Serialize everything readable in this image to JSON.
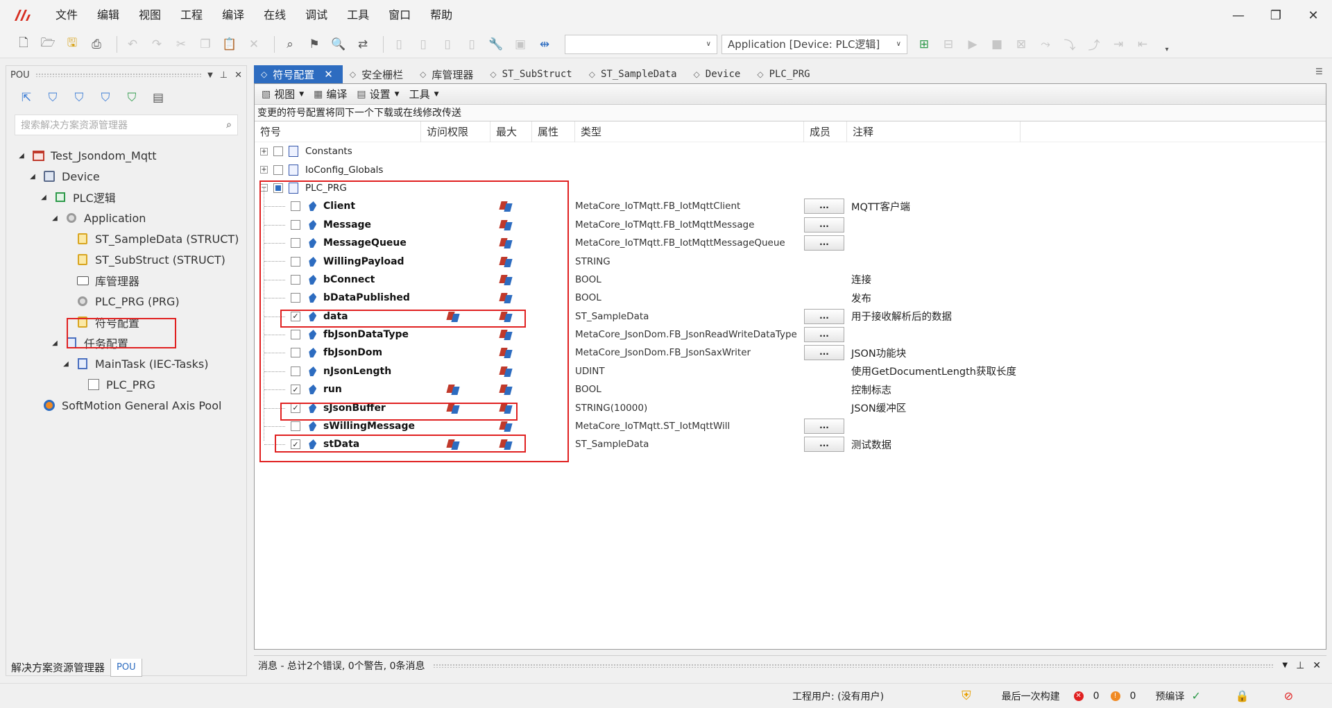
{
  "menu": [
    "文件",
    "编辑",
    "视图",
    "工程",
    "编译",
    "在线",
    "调试",
    "工具",
    "窗口",
    "帮助"
  ],
  "window_controls": {
    "minimize": "—",
    "restore": "❐",
    "close": "✕"
  },
  "toolbar": {
    "device_combo_value": "",
    "app_combo_value": "Application [Device: PLC逻辑]"
  },
  "left_panel": {
    "title": "POU",
    "search_placeholder": "搜索解决方案资源管理器",
    "tree": [
      {
        "label": "Test_Jsondom_Mqtt",
        "level": 0,
        "icon": "project-icon",
        "toggle": "◢"
      },
      {
        "label": "Device",
        "level": 1,
        "icon": "device-icon",
        "toggle": "◢"
      },
      {
        "label": "PLC逻辑",
        "level": 2,
        "icon": "plc-logic-icon",
        "toggle": "◢"
      },
      {
        "label": "Application",
        "level": 3,
        "icon": "application-icon",
        "toggle": "◢"
      },
      {
        "label": "ST_SampleData (STRUCT)",
        "level": 4,
        "icon": "struct-icon",
        "toggle": ""
      },
      {
        "label": "ST_SubStruct (STRUCT)",
        "level": 4,
        "icon": "struct-icon",
        "toggle": ""
      },
      {
        "label": "库管理器",
        "level": 4,
        "icon": "library-manager-icon",
        "toggle": ""
      },
      {
        "label": "PLC_PRG (PRG)",
        "level": 4,
        "icon": "program-icon",
        "toggle": ""
      },
      {
        "label": "符号配置",
        "level": 4,
        "icon": "symbol-config-icon",
        "toggle": ""
      },
      {
        "label": "任务配置",
        "level": 3,
        "icon": "task-config-icon",
        "toggle": "◢"
      },
      {
        "label": "MainTask (IEC-Tasks)",
        "level": 4,
        "icon": "task-icon",
        "toggle": "◢"
      },
      {
        "label": "PLC_PRG",
        "level": 5,
        "icon": "program-call-icon",
        "toggle": ""
      },
      {
        "label": "SoftMotion General Axis Pool",
        "level": 1,
        "icon": "axis-pool-icon",
        "toggle": ""
      }
    ],
    "bottom_tabs": [
      "解决方案资源管理器",
      "POU"
    ]
  },
  "tabs": [
    {
      "label": "符号配置",
      "active": true
    },
    {
      "label": "安全栅栏",
      "active": false
    },
    {
      "label": "库管理器",
      "active": false
    },
    {
      "label": "ST_SubStruct",
      "active": false
    },
    {
      "label": "ST_SampleData",
      "active": false
    },
    {
      "label": "Device",
      "active": false
    },
    {
      "label": "PLC_PRG",
      "active": false
    }
  ],
  "editor": {
    "toolbar": [
      "视图",
      "编译",
      "设置",
      "工具"
    ],
    "note": "变更的符号配置将同下一个下载或在线修改传送",
    "columns": [
      "符号",
      "访问权限",
      "最大",
      "属性",
      "类型",
      "成员",
      "注释"
    ],
    "groups": [
      {
        "name": "Constants",
        "checked": false,
        "expanded": false
      },
      {
        "name": "IoConfig_Globals",
        "checked": false,
        "expanded": false
      },
      {
        "name": "PLC_PRG",
        "checked": "partial",
        "expanded": true
      }
    ],
    "rows": [
      {
        "name": "Client",
        "checked": false,
        "access": false,
        "type": "MetaCore_IoTMqtt.FB_IotMqttClient",
        "member": true,
        "comment": "MQTT客户端"
      },
      {
        "name": "Message",
        "checked": false,
        "access": false,
        "type": "MetaCore_IoTMqtt.FB_IotMqttMessage",
        "member": true,
        "comment": ""
      },
      {
        "name": "MessageQueue",
        "checked": false,
        "access": false,
        "type": "MetaCore_IoTMqtt.FB_IotMqttMessageQueue",
        "member": true,
        "comment": ""
      },
      {
        "name": "WillingPayload",
        "checked": false,
        "access": false,
        "type": "STRING",
        "member": false,
        "comment": ""
      },
      {
        "name": "bConnect",
        "checked": false,
        "access": false,
        "type": "BOOL",
        "member": false,
        "comment": "连接"
      },
      {
        "name": "bDataPublished",
        "checked": false,
        "access": false,
        "type": "BOOL",
        "member": false,
        "comment": "发布"
      },
      {
        "name": "data",
        "checked": true,
        "access": true,
        "type": "ST_SampleData",
        "member": true,
        "comment": "用于接收解析后的数据"
      },
      {
        "name": "fbJsonDataType",
        "checked": false,
        "access": false,
        "type": "MetaCore_JsonDom.FB_JsonReadWriteDataType",
        "member": true,
        "comment": ""
      },
      {
        "name": "fbJsonDom",
        "checked": false,
        "access": false,
        "type": "MetaCore_JsonDom.FB_JsonSaxWriter",
        "member": true,
        "comment": "JSON功能块"
      },
      {
        "name": "nJsonLength",
        "checked": false,
        "access": false,
        "type": "UDINT",
        "member": false,
        "comment": "使用GetDocumentLength获取长度"
      },
      {
        "name": "run",
        "checked": true,
        "access": true,
        "type": "BOOL",
        "member": false,
        "comment": "控制标志"
      },
      {
        "name": "sJsonBuffer",
        "checked": true,
        "access": true,
        "type": "STRING(10000)",
        "member": false,
        "comment": "JSON缓冲区"
      },
      {
        "name": "sWillingMessage",
        "checked": false,
        "access": false,
        "type": "MetaCore_IoTMqtt.ST_IotMqttWill",
        "member": true,
        "comment": ""
      },
      {
        "name": "stData",
        "checked": true,
        "access": true,
        "type": "ST_SampleData",
        "member": true,
        "comment": "测试数据"
      }
    ],
    "member_button_label": "..."
  },
  "messages": {
    "label": "消息 - 总计2个错误, 0个警告, 0条消息"
  },
  "statusbar": {
    "user": "工程用户: (没有用户)",
    "last_build": "最后一次构建",
    "errors": "0",
    "warnings": "0",
    "precompile": "预编译"
  },
  "colors": {
    "accent": "#2d6cc0",
    "highlight": "#e02020"
  }
}
